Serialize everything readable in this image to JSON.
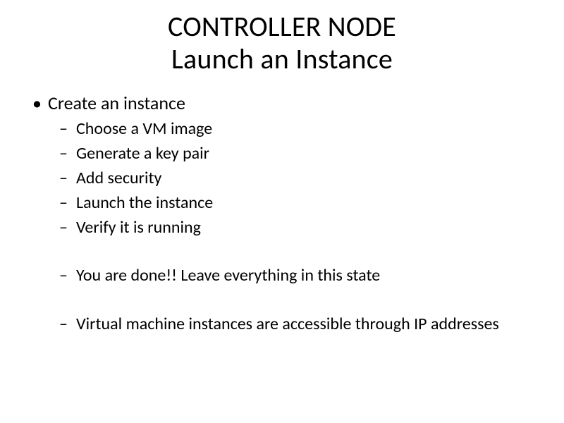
{
  "title": {
    "line1": "CONTROLLER NODE",
    "line2": "Launch an Instance"
  },
  "bullets": [
    {
      "label": "Create an instance",
      "subitems": [
        {
          "text": "Choose a VM image",
          "spaced": false
        },
        {
          "text": "Generate a key pair",
          "spaced": false
        },
        {
          "text": "Add security",
          "spaced": false
        },
        {
          "text": "Launch the instance",
          "spaced": false
        },
        {
          "text": "Verify it is running",
          "spaced": false
        },
        {
          "text": "You are done!!  Leave everything in this state",
          "spaced": true
        },
        {
          "text": "Virtual machine instances are accessible through IP addresses",
          "spaced": true
        }
      ]
    }
  ]
}
